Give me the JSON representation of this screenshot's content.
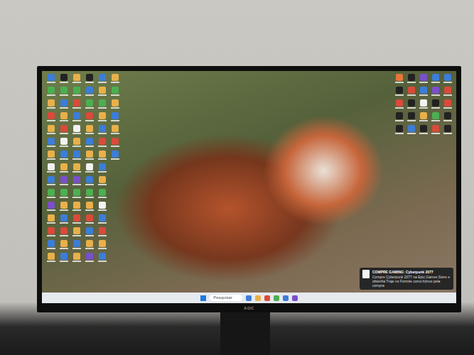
{
  "monitor": {
    "brand": "AOC"
  },
  "desktop": {
    "left_icons": [
      {
        "color": "#3b7dd8"
      },
      {
        "color": "#4caf50"
      },
      {
        "color": "#e8b04a"
      },
      {
        "color": "#d94a3a"
      },
      {
        "color": "#e8b04a"
      },
      {
        "color": "#3b7dd8"
      },
      {
        "color": "#e8b04a"
      },
      {
        "color": "#f2f2f2"
      },
      {
        "color": "#3b7dd8"
      },
      {
        "color": "#4caf50"
      },
      {
        "color": "#7a4fc9"
      },
      {
        "color": "#e8b04a"
      },
      {
        "color": "#d94a3a"
      },
      {
        "color": "#3b7dd8"
      },
      {
        "color": "#e8b04a"
      },
      {
        "color": "#222222"
      },
      {
        "color": "#4caf50"
      },
      {
        "color": "#3b7dd8"
      },
      {
        "color": "#e8b04a"
      },
      {
        "color": "#d94a3a"
      },
      {
        "color": "#f2f2f2"
      },
      {
        "color": "#3b7dd8"
      },
      {
        "color": "#e8b04a"
      },
      {
        "color": "#7a4fc9"
      },
      {
        "color": "#4caf50"
      },
      {
        "color": "#e8b04a"
      },
      {
        "color": "#3b7dd8"
      },
      {
        "color": "#d94a3a"
      },
      {
        "color": "#e8b04a"
      },
      {
        "color": "#3b7dd8"
      },
      {
        "color": "#e8b04a"
      },
      {
        "color": "#4caf50"
      },
      {
        "color": "#d94a3a"
      },
      {
        "color": "#3b7dd8"
      },
      {
        "color": "#f2f2f2"
      },
      {
        "color": "#e8b04a"
      },
      {
        "color": "#3b7dd8"
      },
      {
        "color": "#e8b04a"
      },
      {
        "color": "#7a4fc9"
      },
      {
        "color": "#4caf50"
      },
      {
        "color": "#e8b04a"
      },
      {
        "color": "#d94a3a"
      },
      {
        "color": "#e8b04a"
      },
      {
        "color": "#3b7dd8"
      },
      {
        "color": "#e8b04a"
      },
      {
        "color": "#222222"
      },
      {
        "color": "#3b7dd8"
      },
      {
        "color": "#4caf50"
      },
      {
        "color": "#d94a3a"
      },
      {
        "color": "#e8b04a"
      },
      {
        "color": "#3b7dd8"
      },
      {
        "color": "#e8b04a"
      },
      {
        "color": "#f2f2f2"
      },
      {
        "color": "#3b7dd8"
      },
      {
        "color": "#4caf50"
      },
      {
        "color": "#e8b04a"
      },
      {
        "color": "#d94a3a"
      },
      {
        "color": "#3b7dd8"
      },
      {
        "color": "#e8b04a"
      },
      {
        "color": "#7a4fc9"
      },
      {
        "color": "#3b7dd8"
      },
      {
        "color": "#e8b04a"
      },
      {
        "color": "#4caf50"
      },
      {
        "color": "#e8b04a"
      },
      {
        "color": "#3b7dd8"
      },
      {
        "color": "#d94a3a"
      },
      {
        "color": "#e8b04a"
      },
      {
        "color": "#3b7dd8"
      },
      {
        "color": "#e8b04a"
      },
      {
        "color": "#4caf50"
      },
      {
        "color": "#f2f2f2"
      },
      {
        "color": "#3b7dd8"
      },
      {
        "color": "#d94a3a"
      },
      {
        "color": "#e8b04a"
      },
      {
        "color": "#3b7dd8"
      },
      {
        "color": "#e8b04a"
      },
      {
        "color": "#4caf50"
      },
      {
        "color": "#e8b04a"
      },
      {
        "color": "#3b7dd8"
      },
      {
        "color": "#e8b04a"
      },
      {
        "color": "#d94a3a"
      },
      {
        "color": "#3b7dd8"
      }
    ],
    "right_icons": [
      {
        "color": "#e8743a"
      },
      {
        "color": "#222222"
      },
      {
        "color": "#7a4fc9"
      },
      {
        "color": "#3b7dd8"
      },
      {
        "color": "#3b7dd8"
      },
      {
        "color": "#222222"
      },
      {
        "color": "#d94a3a"
      },
      {
        "color": "#3b7dd8"
      },
      {
        "color": "#7a4fc9"
      },
      {
        "color": "#d94a3a"
      },
      {
        "color": "#d94a3a"
      },
      {
        "color": "#222222"
      },
      {
        "color": "#f2f2f2"
      },
      {
        "color": "#222222"
      },
      {
        "color": "#d94a3a"
      },
      {
        "color": "#222222"
      },
      {
        "color": "#222222"
      },
      {
        "color": "#e8b04a"
      },
      {
        "color": "#4caf50"
      },
      {
        "color": "#222222"
      },
      {
        "color": "#222222"
      },
      {
        "color": "#3b7dd8"
      },
      {
        "color": "#222222"
      },
      {
        "color": "#d94a3a"
      },
      {
        "color": "#222222"
      }
    ]
  },
  "notification": {
    "title": "COMPRE GAMING: Cyberpunk 2077",
    "body": "Compre Cyberpunk 2077 na Epic Games Store e obtenha Traje no Fortnite como bônus pela compra"
  },
  "taskbar": {
    "search": {
      "placeholder": "Pesquisar"
    },
    "apps": [
      {
        "color": "#3b7dd8"
      },
      {
        "color": "#e8b04a"
      },
      {
        "color": "#d94a3a"
      },
      {
        "color": "#4caf50"
      },
      {
        "color": "#3b7dd8"
      },
      {
        "color": "#7a4fc9"
      }
    ]
  }
}
